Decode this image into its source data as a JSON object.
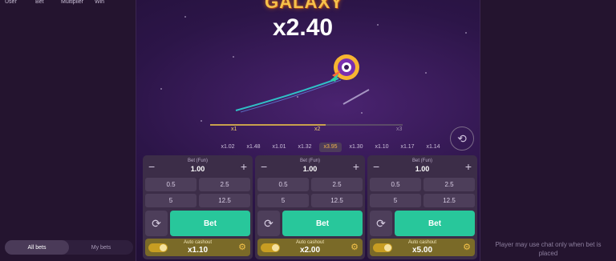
{
  "left_panel": {
    "columns": [
      "User",
      "Bet",
      "Multiplier",
      "Win"
    ],
    "tabs": [
      {
        "label": "All bets",
        "active": true
      },
      {
        "label": "My bets",
        "active": false
      }
    ]
  },
  "game": {
    "logo": "GALAXY",
    "multiplier": "x2.40",
    "timeline_labels": [
      "x1",
      "x2",
      "x3"
    ],
    "history": [
      "x1.02",
      "x1.48",
      "x1.01",
      "x1.32",
      "x3.95",
      "x1.30",
      "x1.10",
      "x1.17",
      "x1.14"
    ],
    "history_selected_index": 4
  },
  "bet_panels": [
    {
      "caption": "Bet (Fun)",
      "value": "1.00",
      "chips": [
        "0.5",
        "2.5",
        "5",
        "12.5"
      ],
      "bet_label": "Bet",
      "cashout_label": "Auto cashout",
      "cashout_value": "x1.10"
    },
    {
      "caption": "Bet (Fun)",
      "value": "1.00",
      "chips": [
        "0.5",
        "2.5",
        "5",
        "12.5"
      ],
      "bet_label": "Bet",
      "cashout_label": "Auto cashout",
      "cashout_value": "x2.00"
    },
    {
      "caption": "Bet (Fun)",
      "value": "1.00",
      "chips": [
        "0.5",
        "2.5",
        "5",
        "12.5"
      ],
      "bet_label": "Bet",
      "cashout_label": "Auto cashout",
      "cashout_value": "x5.00"
    }
  ],
  "right_panel": {
    "chat_note": "Player may use chat only when bet is placed"
  },
  "colors": {
    "bet_button": "#28c79b",
    "accent": "#f3b34a"
  }
}
